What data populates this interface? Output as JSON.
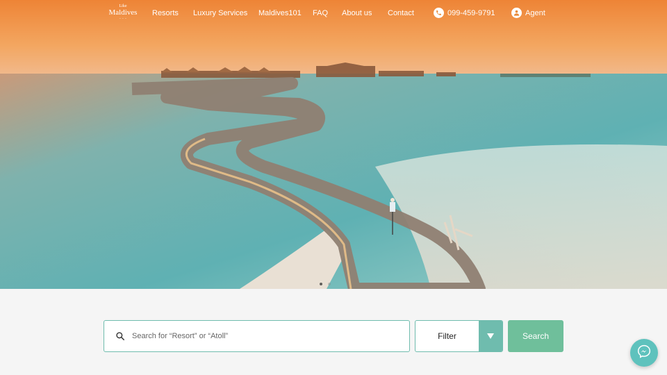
{
  "brand": {
    "line1": "Like",
    "line2": "Maldives",
    "line3": "~ ~ ~"
  },
  "nav": {
    "items": [
      {
        "label": "Resorts"
      },
      {
        "label": "Luxury Services"
      },
      {
        "label": "Maldives101"
      },
      {
        "label": "FAQ"
      },
      {
        "label": "About us"
      },
      {
        "label": "Contact"
      }
    ],
    "phone": "099-459-9791",
    "agent": "Agent"
  },
  "hero": {
    "carousel_dots": 2,
    "active_dot": 1
  },
  "search": {
    "placeholder": "Search for “Resort” or “Atoll”",
    "filter_label": "Filter",
    "button_label": "Search"
  },
  "colors": {
    "accent": "#6fbcae",
    "button": "#6fbf9b",
    "messenger": "#5ec2bd"
  },
  "icons": [
    "search-icon",
    "chevron-down-icon",
    "phone-icon",
    "user-icon",
    "messenger-icon"
  ]
}
